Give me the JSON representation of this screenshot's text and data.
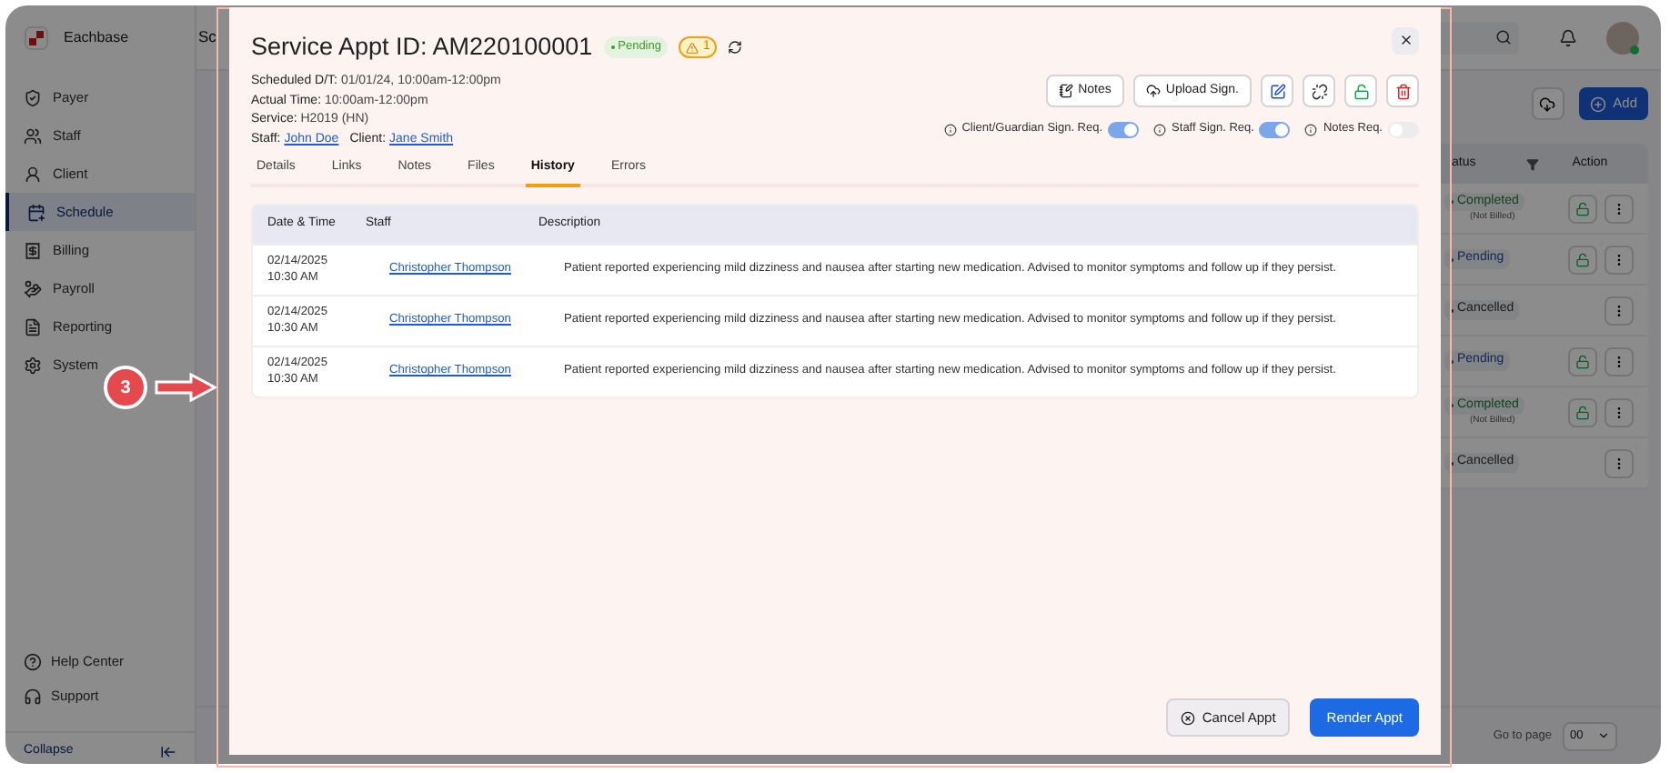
{
  "sidebar": {
    "brand": "Eachbase",
    "items": [
      {
        "label": "Payer",
        "selected": false
      },
      {
        "label": "Staff",
        "selected": false
      },
      {
        "label": "Client",
        "selected": false
      },
      {
        "label": "Schedule",
        "selected": true
      },
      {
        "label": "Billing",
        "selected": false
      },
      {
        "label": "Payroll",
        "selected": false
      },
      {
        "label": "Reporting",
        "selected": false
      },
      {
        "label": "System",
        "selected": false
      }
    ],
    "footer_items": [
      "Help Center",
      "Support"
    ],
    "collapse": "Collapse"
  },
  "page_title": "Sc",
  "add_button": "Add",
  "background_table": {
    "columns": [
      "atus",
      "Action"
    ],
    "rows": [
      {
        "status": "Completed",
        "note": "(Not Billed)",
        "kind": "completed",
        "lockable": true
      },
      {
        "status": "Pending",
        "kind": "pending",
        "lockable": true
      },
      {
        "status": "Cancelled",
        "kind": "cancelled",
        "lockable": false
      },
      {
        "status": "Pending",
        "kind": "pending",
        "lockable": true
      },
      {
        "status": "Completed",
        "note": "(Not Billed)",
        "kind": "completed",
        "lockable": true
      },
      {
        "status": "Cancelled",
        "kind": "cancelled",
        "lockable": false
      }
    ]
  },
  "pagination": {
    "label": "Go to page",
    "value": "00"
  },
  "annotation": {
    "label": "3"
  },
  "modal": {
    "title": "Service Appt ID: AM220100001",
    "status": "Pending",
    "warning_count": "1",
    "details": [
      {
        "label": "Scheduled D/T:",
        "value": "01/01/24, 10:00am-12:00pm"
      },
      {
        "label": "Actual Time:",
        "value": "10:00am-12:00pm"
      },
      {
        "label": "Service:",
        "value": "H2019 (HN)"
      }
    ],
    "people": [
      {
        "label": "Staff:",
        "name": "John Doe"
      },
      {
        "label": "Client:",
        "name": "Jane Smith"
      }
    ],
    "buttons": [
      "Notes",
      "Upload Sign."
    ],
    "icon_buttons": [
      {
        "kind": "edit"
      },
      {
        "kind": "unlink"
      },
      {
        "kind": "unlock"
      },
      {
        "kind": "delete"
      }
    ],
    "toggles": [
      {
        "label": "Client/Guardian Sign. Req.",
        "on": true
      },
      {
        "label": "Staff Sign. Req.",
        "on": true
      },
      {
        "label": "Notes Req.",
        "on": false
      }
    ],
    "tabs": [
      {
        "label": "Details",
        "selected": false
      },
      {
        "label": "Links",
        "selected": false
      },
      {
        "label": "Notes",
        "selected": false
      },
      {
        "label": "Files",
        "selected": false
      },
      {
        "label": "History",
        "selected": true
      },
      {
        "label": "Errors",
        "selected": false
      }
    ],
    "history": {
      "columns": [
        "Date & Time",
        "Staff",
        "Description"
      ],
      "rows": [
        {
          "date": "02/14/2025",
          "time": "10:30 AM",
          "staff": "Christopher Thompson",
          "description": "Patient reported experiencing mild dizziness and nausea after starting new medication. Advised to monitor symptoms and follow up if they persist."
        },
        {
          "date": "02/14/2025",
          "time": "10:30 AM",
          "staff": "Christopher Thompson",
          "description": "Patient reported experiencing mild dizziness and nausea after starting new medication. Advised to monitor symptoms and follow up if they persist."
        },
        {
          "date": "02/14/2025",
          "time": "10:30 AM",
          "staff": "Christopher Thompson",
          "description": "Patient reported experiencing mild dizziness and nausea after starting new medication. Advised to monitor symptoms and follow up if they persist."
        }
      ]
    },
    "footer": [
      {
        "label": "Cancel Appt",
        "kind": "secondary"
      },
      {
        "label": "Render Appt",
        "kind": "primary"
      }
    ]
  }
}
